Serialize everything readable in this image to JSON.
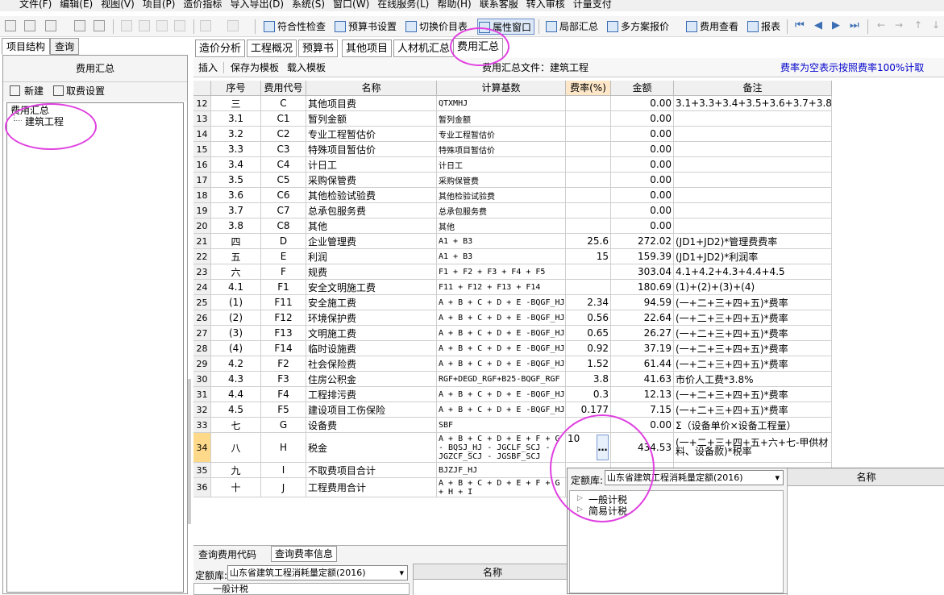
{
  "menu": [
    "文件(F)",
    "编辑(E)",
    "视图(V)",
    "项目(P)",
    "造价指标",
    "导入导出(D)",
    "系统(S)",
    "窗口(W)",
    "在线服务(L)",
    "帮助(H)",
    "联系客服",
    "转入审核",
    "计量支付"
  ],
  "toolbar": {
    "check": "符合性检查",
    "budget": "预算书设置",
    "switch": "切换价目表",
    "props": "属性窗口",
    "local": "局部汇总",
    "multi": "多方案报价",
    "feeview": "费用查看",
    "report": "报表"
  },
  "left": {
    "tab_struct": "项目结构",
    "tab_query": "查询",
    "title": "费用汇总",
    "new_label": "新建",
    "cancel_label": "取费设置",
    "tree_root": "费用汇总",
    "tree_child": "建筑工程"
  },
  "tabs": [
    "造价分析",
    "工程概况",
    "预算书",
    "其他项目",
    "人材机汇总",
    "费用汇总"
  ],
  "subbar": {
    "insert": "插入",
    "save_tpl": "保存为模板",
    "load_tpl": "载入模板",
    "file_label": "费用汇总文件：建筑工程",
    "hint": "费率为空表示按照费率100%计取"
  },
  "grid": {
    "headers": [
      "",
      "序号",
      "费用代号",
      "名称",
      "计算基数",
      "费率(%)",
      "金额",
      "备注"
    ],
    "rows": [
      [
        "12",
        "三",
        "C",
        "其他项目费",
        "QTXMHJ",
        "",
        "0.00",
        "3.1+3.3+3.4+3.5+3.6+3.7+3.8"
      ],
      [
        "13",
        "3.1",
        "C1",
        "暂列金额",
        "暂列金额",
        "",
        "0.00",
        ""
      ],
      [
        "14",
        "3.2",
        "C2",
        "专业工程暂估价",
        "专业工程暂估价",
        "",
        "0.00",
        ""
      ],
      [
        "15",
        "3.3",
        "C3",
        "特殊项目暂估价",
        "特殊项目暂估价",
        "",
        "0.00",
        ""
      ],
      [
        "16",
        "3.4",
        "C4",
        "计日工",
        "计日工",
        "",
        "0.00",
        ""
      ],
      [
        "17",
        "3.5",
        "C5",
        "采购保管费",
        "采购保管费",
        "",
        "0.00",
        ""
      ],
      [
        "18",
        "3.6",
        "C6",
        "其他检验试验费",
        "其他检验试验费",
        "",
        "0.00",
        ""
      ],
      [
        "19",
        "3.7",
        "C7",
        "总承包服务费",
        "总承包服务费",
        "",
        "0.00",
        ""
      ],
      [
        "20",
        "3.8",
        "C8",
        "其他",
        "其他",
        "",
        "0.00",
        ""
      ],
      [
        "21",
        "四",
        "D",
        "企业管理费",
        "A1 + B3",
        "25.6",
        "272.02",
        "(JD1+JD2)*管理费费率"
      ],
      [
        "22",
        "五",
        "E",
        "利润",
        "A1 + B3",
        "15",
        "159.39",
        "(JD1+JD2)*利润率"
      ],
      [
        "23",
        "六",
        "F",
        "规费",
        "F1 + F2 + F3 + F4 + F5",
        "",
        "303.04",
        "4.1+4.2+4.3+4.4+4.5"
      ],
      [
        "24",
        "4.1",
        "F1",
        "安全文明施工费",
        "F11 + F12 + F13 + F14",
        "",
        "180.69",
        "(1)+(2)+(3)+(4)"
      ],
      [
        "25",
        "(1)",
        "F11",
        "安全施工费",
        "A + B + C + D + E -BQGF_HJ",
        "2.34",
        "94.59",
        "(一+二+三+四+五)*费率"
      ],
      [
        "26",
        "(2)",
        "F12",
        "环境保护费",
        "A + B + C + D + E -BQGF_HJ",
        "0.56",
        "22.64",
        "(一+二+三+四+五)*费率"
      ],
      [
        "27",
        "(3)",
        "F13",
        "文明施工费",
        "A + B + C + D + E -BQGF_HJ",
        "0.65",
        "26.27",
        "(一+二+三+四+五)*费率"
      ],
      [
        "28",
        "(4)",
        "F14",
        "临时设施费",
        "A + B + C + D + E -BQGF_HJ",
        "0.92",
        "37.19",
        "(一+二+三+四+五)*费率"
      ],
      [
        "29",
        "4.2",
        "F2",
        "社会保险费",
        "A + B + C + D + E -BQGF_HJ",
        "1.52",
        "61.44",
        "(一+二+三+四+五)*费率"
      ],
      [
        "30",
        "4.3",
        "F3",
        "住房公积金",
        "RGF+DEGD_RGF+B25-BQGF_RGF",
        "3.8",
        "41.63",
        "市价人工费*3.8%"
      ],
      [
        "31",
        "4.4",
        "F4",
        "工程排污费",
        "A + B + C + D + E -BQGF_HJ",
        "0.3",
        "12.13",
        "(一+二+三+四+五)*费率"
      ],
      [
        "32",
        "4.5",
        "F5",
        "建设项目工伤保险",
        "A + B + C + D + E -BQGF_HJ",
        "0.177",
        "7.15",
        "(一+二+三+四+五)*费率"
      ],
      [
        "33",
        "七",
        "G",
        "设备费",
        "SBF",
        "",
        "0.00",
        "Σ（设备单价×设备工程量）"
      ],
      [
        "34",
        "八",
        "H",
        "税金",
        "A + B + C + D + E + F + G - BQSJ_HJ - JGCLF_SCJ - JGZCF_SCJ - JGSBF_SCJ",
        "10",
        "434.53",
        "(一+二+三+四+五+六+七-甲供材料、设备款)*税率"
      ],
      [
        "35",
        "九",
        "I",
        "不取费项目合计",
        "BJZJF_HJ",
        "",
        "",
        ""
      ],
      [
        "36",
        "十",
        "J",
        "工程费用合计",
        "A + B + C + D + E + F + G + H + I",
        "",
        "",
        ""
      ]
    ]
  },
  "bottom": {
    "tab_code": "查询费用代码",
    "tab_rate": "查询费率信息",
    "lib_label": "定额库:",
    "lib_value": "山东省建筑工程消耗量定额(2016)",
    "name_header": "名称",
    "tree_item": "一般计税"
  },
  "popup": {
    "lib_label": "定额库:",
    "lib_value": "山东省建筑工程消耗量定额(2016)",
    "name_header": "名称",
    "item1": "一般计税",
    "item2": "简易计税"
  },
  "colors": {
    "accent": "#0000cc",
    "highlight_ring": "#e040e0",
    "selected_row": "#fff2cc"
  }
}
